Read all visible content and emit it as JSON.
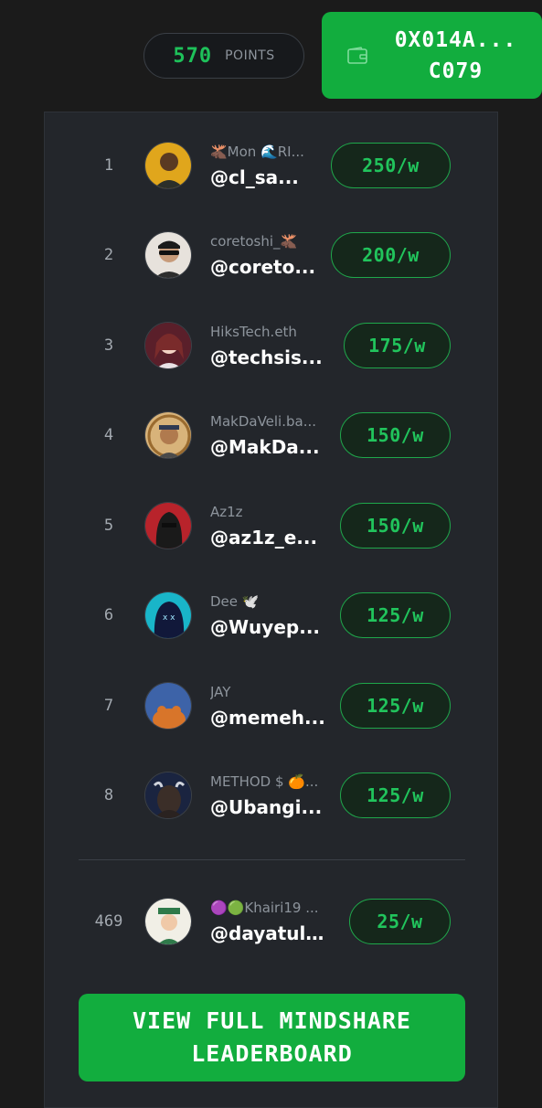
{
  "points": {
    "value": "570",
    "label": "POINTS"
  },
  "wallet": {
    "address": "0X014A... C079",
    "icon": "wallet-icon"
  },
  "leaderboard": {
    "rows": [
      {
        "rank": "1",
        "name": "🫎Mon 🌊RI...",
        "handle": "@cl_sa...",
        "reward": "250/w"
      },
      {
        "rank": "2",
        "name": "coretoshi_🫎",
        "handle": "@coreto...",
        "reward": "200/w"
      },
      {
        "rank": "3",
        "name": "HiksTech.eth",
        "handle": "@techsis...",
        "reward": "175/w"
      },
      {
        "rank": "4",
        "name": "MakDaVeli.ba...",
        "handle": "@MakDa...",
        "reward": "150/w"
      },
      {
        "rank": "5",
        "name": "Az1z",
        "handle": "@az1z_e...",
        "reward": "150/w"
      },
      {
        "rank": "6",
        "name": "Dee 🕊️",
        "handle": "@Wuyep...",
        "reward": "125/w"
      },
      {
        "rank": "7",
        "name": "JAY",
        "handle": "@memeh...",
        "reward": "125/w"
      },
      {
        "rank": "8",
        "name": "METHOD $ 🍊...",
        "handle": "@Ubangi...",
        "reward": "125/w"
      }
    ],
    "current_user": {
      "rank": "469",
      "name": "🟣🟢Khairi19 ...",
      "handle": "@dayatull...",
      "reward": "25/w"
    },
    "view_full_label": "VIEW FULL MINDSHARE LEADERBOARD"
  },
  "colors": {
    "accent": "#12ad3e",
    "accent_text": "#21c45c",
    "background": "#1b1b1b",
    "panel": "#23262b"
  }
}
